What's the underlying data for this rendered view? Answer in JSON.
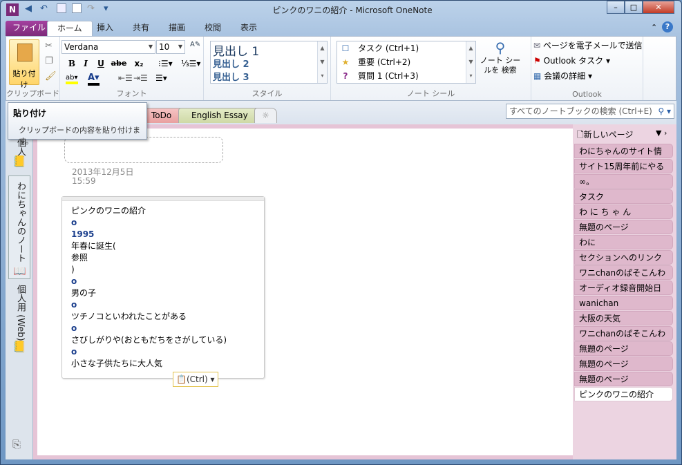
{
  "window": {
    "title": "ピンクのワニの紹介 - Microsoft OneNote",
    "minimize": "–",
    "maximize": "□",
    "close": "✕"
  },
  "qat": {
    "app_icon": "N",
    "back": "◀",
    "undo": "↶",
    "redo": "↷",
    "more": "▾"
  },
  "ribbon_tabs": [
    "ファイル",
    "ホーム",
    "挿入",
    "共有",
    "描画",
    "校閲",
    "表示"
  ],
  "clipboard": {
    "paste_label": "貼り付け",
    "group": "クリップボード"
  },
  "font": {
    "name": "Verdana",
    "size": "10",
    "group": "フォント",
    "bold": "B",
    "italic": "I",
    "underline": "U",
    "strike": "abe",
    "subscript": "x₂"
  },
  "styles": {
    "items": [
      "見出し 1",
      "見出し 2",
      "見出し 3"
    ],
    "group": "スタイル"
  },
  "tags": {
    "items": [
      "タスク (Ctrl+1)",
      "重要 (Ctrl+2)",
      "質問 1 (Ctrl+3)"
    ],
    "find_label": "ノート シールを 検索",
    "group": "ノート シール"
  },
  "outlook": {
    "items": [
      "ページを電子メールで送信",
      "Outlook タスク",
      "会議の詳細"
    ],
    "group": "Outlook"
  },
  "tooltip": {
    "title": "貼り付け",
    "body": "クリップボードの内容を貼り付けます。"
  },
  "section_tabs": [
    "ToDo",
    "English Essay",
    "☼"
  ],
  "search": {
    "placeholder": "すべてのノートブックの検索 (Ctrl+E)"
  },
  "notebooks": [
    "個人",
    "わにちゃんのノート",
    "個人用 (Web)"
  ],
  "page": {
    "date": "2013年12月5日",
    "time": "15:59",
    "outline": [
      "ピンクのワニの紹介",
      "o",
      "1995",
      "年春に誕生(",
      "参照",
      ")",
      "o",
      "男の子",
      "o",
      "ツチノコといわれたことがある",
      "o",
      "さびしがりや(おともだちをさがしている)",
      "o",
      "小さな子供たちに大人気"
    ],
    "paste_options": "(Ctrl)"
  },
  "pagelist": {
    "new_page": "新しいページ",
    "pages": [
      "わにちゃんのサイト情",
      "サイト15周年前にやる",
      "∞。",
      "タスク",
      "わ に ち ゃ ん",
      "無題のページ",
      "わに",
      "セクションへのリンク",
      "ワニchanのぱそこんわ",
      "オーディオ録音開始日",
      "wanichan",
      "大阪の天気",
      "ワニchanのぱそこんわ",
      "無題のページ",
      "無題のページ",
      "無題のページ",
      "ピンクのワニの紹介"
    ],
    "selected": 16
  }
}
